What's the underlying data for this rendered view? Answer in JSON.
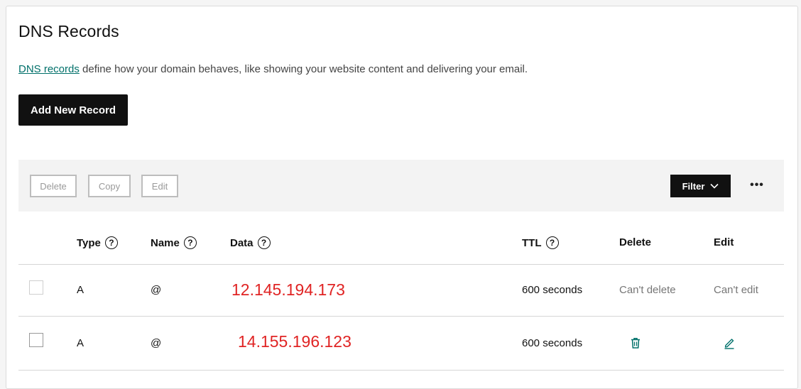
{
  "page": {
    "title": "DNS Records",
    "description_link": "DNS records",
    "description_rest": " define how your domain behaves, like showing your website content and delivering your email.",
    "add_button": "Add New Record"
  },
  "toolbar": {
    "delete_label": "Delete",
    "copy_label": "Copy",
    "edit_label": "Edit",
    "filter_label": "Filter",
    "more_label": "•••"
  },
  "table": {
    "headers": {
      "type": "Type",
      "name": "Name",
      "data": "Data",
      "ttl": "TTL",
      "delete": "Delete",
      "edit": "Edit"
    },
    "help_glyph": "?",
    "rows": [
      {
        "type": "A",
        "name": "@",
        "data": "12.145.194.173",
        "ttl": "600 seconds",
        "delete": "Can't delete",
        "edit": "Can't edit",
        "editable": false
      },
      {
        "type": "A",
        "name": "@",
        "data": "14.155.196.123",
        "ttl": "600 seconds",
        "delete": "trash-icon",
        "edit": "pencil-icon",
        "editable": true
      }
    ]
  },
  "colors": {
    "link": "#00706a",
    "ip_highlight": "#e02424",
    "primary_button": "#111111"
  }
}
